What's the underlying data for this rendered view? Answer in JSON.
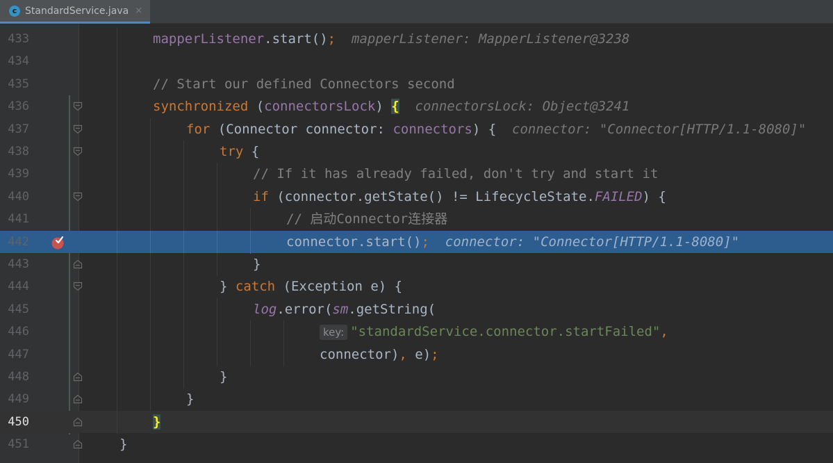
{
  "tab": {
    "icon_letter": "c",
    "label": "StandardService.java",
    "close_icon": "×"
  },
  "lines": [
    {
      "num": "433",
      "tokens": [
        {
          "t": "mapperListener",
          "c": "fld"
        },
        {
          "t": ".start()",
          "c": ""
        },
        {
          "t": ";",
          "c": "kw"
        },
        {
          "t": "  mapperListener: MapperListener@3238",
          "c": "hint"
        }
      ]
    },
    {
      "num": "434",
      "tokens": []
    },
    {
      "num": "435",
      "tokens": [
        {
          "t": "// Start our defined Connectors second",
          "c": "cmt"
        }
      ]
    },
    {
      "num": "436",
      "tokens": [
        {
          "t": "synchronized",
          "c": "kw"
        },
        {
          "t": " (",
          "c": ""
        },
        {
          "t": "connectorsLock",
          "c": "fld"
        },
        {
          "t": ") ",
          "c": ""
        },
        {
          "t": "{",
          "c": "brace-hl"
        },
        {
          "t": "  connectorsLock: Object@3241",
          "c": "hint"
        }
      ]
    },
    {
      "num": "437",
      "tokens": [
        {
          "t": "for",
          "c": "kw"
        },
        {
          "t": " (Connector connector: ",
          "c": ""
        },
        {
          "t": "connectors",
          "c": "fld"
        },
        {
          "t": ") {",
          "c": ""
        },
        {
          "t": "  connector: \"Connector[HTTP/1.1-8080]\"",
          "c": "hint"
        }
      ]
    },
    {
      "num": "438",
      "tokens": [
        {
          "t": "try",
          "c": "kw"
        },
        {
          "t": " {",
          "c": ""
        }
      ]
    },
    {
      "num": "439",
      "tokens": [
        {
          "t": "// If it has already failed, don't try and start it",
          "c": "cmt"
        }
      ]
    },
    {
      "num": "440",
      "tokens": [
        {
          "t": "if",
          "c": "kw"
        },
        {
          "t": " (connector.getState() != LifecycleState.",
          "c": ""
        },
        {
          "t": "FAILED",
          "c": "cst"
        },
        {
          "t": ") {",
          "c": ""
        }
      ]
    },
    {
      "num": "441",
      "tokens": [
        {
          "t": "// 启动Connector连接器",
          "c": "cmt"
        }
      ]
    },
    {
      "num": "442",
      "tokens": [
        {
          "t": "connector.start()",
          "c": ""
        },
        {
          "t": ";",
          "c": "kw"
        },
        {
          "t": "  connector: \"Connector[HTTP/1.1-8080]\"",
          "c": "hint"
        }
      ]
    },
    {
      "num": "443",
      "tokens": [
        {
          "t": "}",
          "c": ""
        }
      ]
    },
    {
      "num": "444",
      "tokens": [
        {
          "t": "} ",
          "c": ""
        },
        {
          "t": "catch",
          "c": "kw"
        },
        {
          "t": " (Exception e) {",
          "c": ""
        }
      ]
    },
    {
      "num": "445",
      "tokens": [
        {
          "t": "log",
          "c": "lgr"
        },
        {
          "t": ".error(",
          "c": ""
        },
        {
          "t": "sm",
          "c": "lgr"
        },
        {
          "t": ".getString(",
          "c": ""
        }
      ]
    },
    {
      "num": "446",
      "tokens": [
        {
          "t": "key:",
          "c": "param-hint"
        },
        {
          "t": "\"standardService.connector.startFailed\"",
          "c": "str"
        },
        {
          "t": ",",
          "c": "kw"
        }
      ]
    },
    {
      "num": "447",
      "tokens": [
        {
          "t": "connector)",
          "c": ""
        },
        {
          "t": ",",
          "c": "kw"
        },
        {
          "t": " e)",
          "c": ""
        },
        {
          "t": ";",
          "c": "kw"
        }
      ]
    },
    {
      "num": "448",
      "tokens": [
        {
          "t": "}",
          "c": ""
        }
      ]
    },
    {
      "num": "449",
      "tokens": [
        {
          "t": "}",
          "c": ""
        }
      ]
    },
    {
      "num": "450",
      "tokens": [
        {
          "t": "}",
          "c": "brace-hl"
        }
      ]
    },
    {
      "num": "451",
      "tokens": [
        {
          "t": "}",
          "c": ""
        }
      ]
    }
  ]
}
